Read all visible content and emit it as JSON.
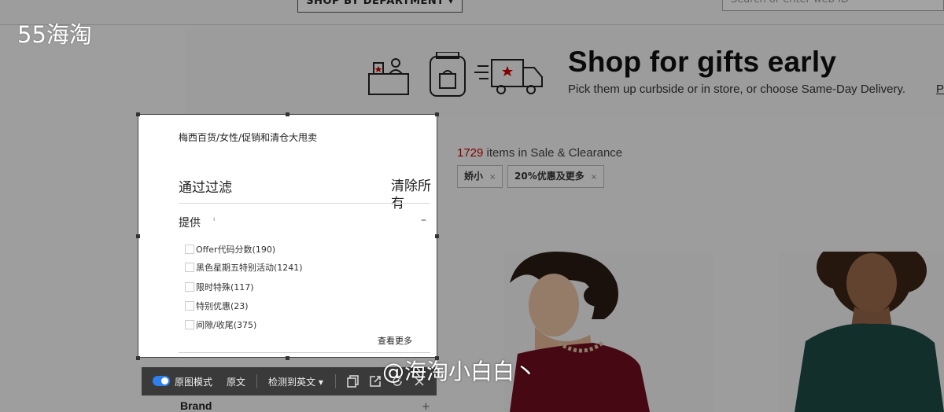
{
  "page": {
    "header": {
      "department_button": "SHOP BY DEPARTMENT ▾",
      "search_placeholder": "Search or enter web ID"
    },
    "banner": {
      "title": "Shop for gifts early",
      "subtitle": "Pick them up curbside or in store, or choose Same-Day Delivery.",
      "cut_link": "P"
    },
    "results": {
      "count": "1729",
      "label": " items in Sale & Clearance",
      "chips": [
        {
          "label": "娇小",
          "remove": "×"
        },
        {
          "label": "20%优惠及更多",
          "remove": "×"
        }
      ]
    },
    "filters_below": {
      "brand_label": "Brand",
      "brand_toggle": "+"
    }
  },
  "panel": {
    "breadcrumb": "梅西百货/女性/促销和清仓大甩卖",
    "filter_title": "通过过滤",
    "clear_all": "清除所有",
    "offer_section": {
      "title": "提供",
      "collapse": "–",
      "options": [
        "Offer代码分数(190)",
        "黑色星期五特别活动(1241)",
        "限时特殊(117)",
        "特别优惠(23)",
        "间隙/收尾(375)"
      ],
      "see_more": "查看更多"
    }
  },
  "toolbar": {
    "image_mode_label": "原图模式",
    "original_label": "原文",
    "detect_label": "检测到英文 ▾",
    "image_mode_on": true
  },
  "watermarks": {
    "top_left": "55海淘",
    "bottom_center": "@海淘小白白丶"
  },
  "colors": {
    "accent_red": "#cc0000",
    "toggle_blue": "#2f80ed",
    "toolbar_bg": "#3a3a3a"
  }
}
